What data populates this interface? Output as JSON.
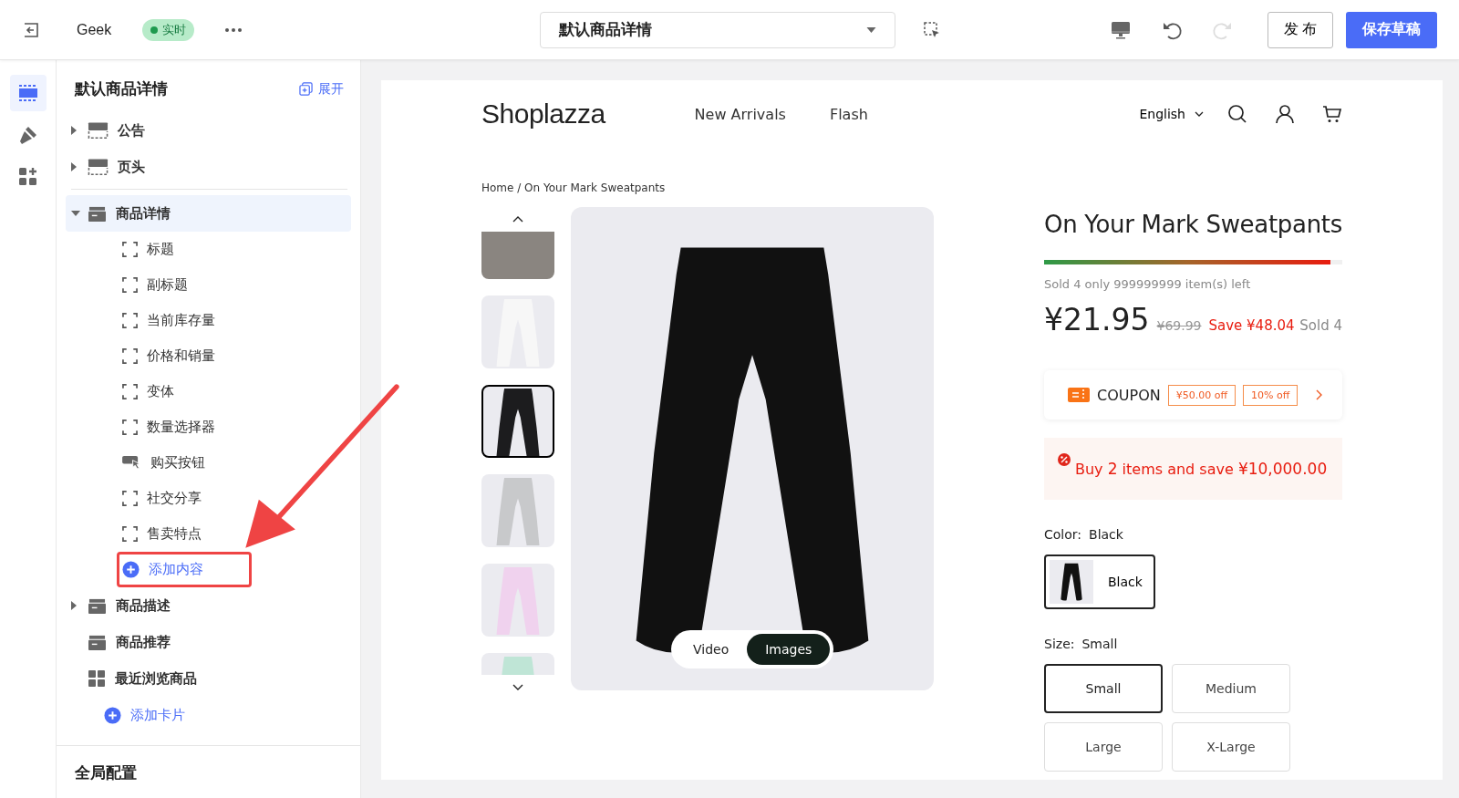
{
  "topbar": {
    "theme_name": "Geek",
    "status_badge": "实时",
    "template_select": "默认商品详情",
    "publish_button": "发 布",
    "save_button": "保存草稿"
  },
  "rail": [
    {
      "kind": "sections",
      "selected": true
    },
    {
      "kind": "theme",
      "selected": false
    },
    {
      "kind": "apps",
      "selected": false
    }
  ],
  "panel": {
    "title": "默认商品详情",
    "expand_link": "展开",
    "footer": "全局配置",
    "fixed_sections": [
      {
        "label": "公告",
        "kind": "header",
        "expanded": false,
        "selected": false
      },
      {
        "label": "页头",
        "kind": "header",
        "expanded": false,
        "selected": false
      }
    ],
    "tree": [
      {
        "label": "商品详情",
        "kind": "section",
        "expanded": true,
        "selected": true,
        "children": [
          {
            "label": "标题",
            "kind": "block",
            "highlighted": false
          },
          {
            "label": "副标题",
            "kind": "block",
            "highlighted": false
          },
          {
            "label": "当前库存量",
            "kind": "block",
            "highlighted": false
          },
          {
            "label": "价格和销量",
            "kind": "block",
            "highlighted": false
          },
          {
            "label": "变体",
            "kind": "block",
            "highlighted": false
          },
          {
            "label": "数量选择器",
            "kind": "block",
            "highlighted": false
          },
          {
            "label": "购买按钮",
            "kind": "button",
            "highlighted": false
          },
          {
            "label": "社交分享",
            "kind": "block",
            "highlighted": false
          },
          {
            "label": "售卖特点",
            "kind": "block",
            "highlighted": false
          },
          {
            "label": "添加内容",
            "kind": "add",
            "highlighted": true
          }
        ]
      },
      {
        "label": "商品描述",
        "kind": "section",
        "expanded": false,
        "selected": false
      },
      {
        "label": "商品推荐",
        "kind": "section",
        "selected": false
      },
      {
        "label": "最近浏览商品",
        "kind": "grid",
        "selected": false
      },
      {
        "label": "添加卡片",
        "kind": "add",
        "selected": false
      }
    ]
  },
  "store": {
    "logo": "Shoplazza",
    "nav": [
      "New Arrivals",
      "Flash"
    ],
    "language": "English",
    "breadcrumb": "Home / On Your Mark Sweatpants",
    "thumbnails": [
      {
        "kind": "photo",
        "color": "#8a8580",
        "selected": false
      },
      {
        "kind": "product",
        "color": "#f7f7f7",
        "selected": false
      },
      {
        "kind": "product",
        "color": "#1c1c1e",
        "selected": true
      },
      {
        "kind": "product",
        "color": "#c8c9cb",
        "selected": false
      },
      {
        "kind": "product",
        "color": "#f0d2ee",
        "selected": false
      },
      {
        "kind": "product",
        "color": "#bfe5d6",
        "selected": false
      }
    ],
    "media_tabs": [
      {
        "label": "Video",
        "selected": false
      },
      {
        "label": "Images",
        "selected": true
      }
    ],
    "product": {
      "title": "On Your Mark Sweatpants",
      "stock": {
        "level": 0.96
      },
      "stock_text": "Sold 4 only 999999999 item(s) left",
      "price": "¥21.95",
      "compare_price": "¥69.99",
      "save": "Save ¥48.04",
      "sold": "Sold 4",
      "coupon": {
        "label": "COUPON",
        "tags": [
          "¥50.00 off",
          "10% off"
        ]
      },
      "promo": "Buy **2** items and save **¥10,000.00**",
      "color_label": "Color:",
      "color_value": "Black",
      "color_options": [
        {
          "label": "Black",
          "selected": true
        }
      ],
      "size_label": "Size:",
      "size_value": "Small",
      "size_options": [
        {
          "label": "Small",
          "selected": true
        },
        {
          "label": "Medium",
          "selected": false
        },
        {
          "label": "Large",
          "selected": false
        },
        {
          "label": "X-Large",
          "selected": false
        }
      ]
    }
  }
}
